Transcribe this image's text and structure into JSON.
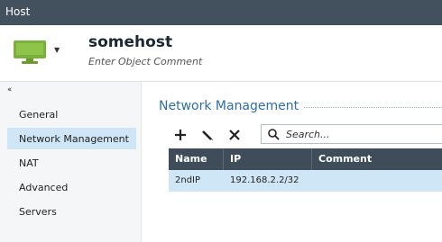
{
  "window": {
    "title": "Host"
  },
  "header": {
    "object_name": "somehost",
    "comment_placeholder": "Enter Object Comment",
    "icon": "host-monitor-icon"
  },
  "sidebar": {
    "collapse_glyph": "‹‹",
    "items": [
      {
        "label": "General",
        "active": false
      },
      {
        "label": "Network Management",
        "active": true
      },
      {
        "label": "NAT",
        "active": false
      },
      {
        "label": "Advanced",
        "active": false
      },
      {
        "label": "Servers",
        "active": false
      }
    ]
  },
  "main": {
    "section_title": "Network Management",
    "toolbar": {
      "add_icon": "plus-icon",
      "edit_icon": "pencil-icon",
      "delete_icon": "x-icon"
    },
    "search": {
      "placeholder": "Search..."
    },
    "table": {
      "columns": [
        "Name",
        "IP",
        "Comment"
      ],
      "rows": [
        {
          "name": "2ndIP",
          "ip": "192.168.2.2/32",
          "comment": ""
        }
      ]
    }
  },
  "colors": {
    "titlebar": "#43505e",
    "accent": "#2f6ea8",
    "selected": "#cfe6f7",
    "icon_green": "#7ab13a",
    "table_header": "#3f4c5a"
  }
}
